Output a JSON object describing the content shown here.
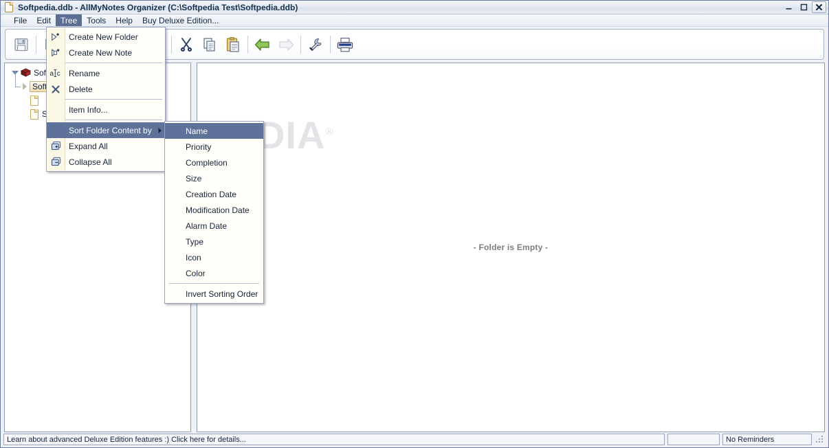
{
  "window": {
    "title": "Softpedia.ddb - AllMyNotes Organizer (C:\\Softpedia Test\\Softpedia.ddb)",
    "title_icon": "document-icon",
    "controls": {
      "minimize": "minimize-icon",
      "maximize": "maximize-icon",
      "close": "close-icon"
    }
  },
  "menubar": {
    "items": [
      {
        "label": "File",
        "active": false
      },
      {
        "label": "Edit",
        "active": false
      },
      {
        "label": "Tree",
        "active": true
      },
      {
        "label": "Tools",
        "active": false
      },
      {
        "label": "Help",
        "active": false
      },
      {
        "label": "Buy Deluxe Edition...",
        "active": false
      }
    ]
  },
  "toolbar": {
    "buttons": [
      {
        "name": "save-icon",
        "enabled": true
      },
      {
        "name": "separator",
        "enabled": false
      },
      {
        "name": "new-folder-icon",
        "enabled": true
      },
      {
        "name": "new-note-icon",
        "enabled": true
      },
      {
        "name": "separator",
        "enabled": false
      },
      {
        "name": "search-icon",
        "enabled": false
      },
      {
        "name": "separator",
        "enabled": false
      },
      {
        "name": "undo-icon",
        "enabled": false
      },
      {
        "name": "redo-icon",
        "enabled": false
      },
      {
        "name": "separator",
        "enabled": false
      },
      {
        "name": "cut-icon",
        "enabled": true
      },
      {
        "name": "copy-icon",
        "enabled": true
      },
      {
        "name": "paste-icon",
        "enabled": true
      },
      {
        "name": "separator",
        "enabled": false
      },
      {
        "name": "back-arrow-icon",
        "enabled": true
      },
      {
        "name": "forward-arrow-icon",
        "enabled": false
      },
      {
        "name": "separator",
        "enabled": false
      },
      {
        "name": "options-wrench-icon",
        "enabled": true
      },
      {
        "name": "separator",
        "enabled": false
      },
      {
        "name": "print-icon",
        "enabled": true
      }
    ]
  },
  "tree_menu": {
    "items": [
      {
        "label": "Create New Folder",
        "icon": "new-folder-icon",
        "type": "item",
        "selected": false
      },
      {
        "label": "Create New Note",
        "icon": "new-note-icon",
        "type": "item",
        "selected": false
      },
      {
        "type": "separator"
      },
      {
        "label": "Rename",
        "icon": "rename-abc-icon",
        "type": "item",
        "selected": false
      },
      {
        "label": "Delete",
        "icon": "delete-x-icon",
        "type": "item",
        "selected": false
      },
      {
        "type": "separator"
      },
      {
        "label": "Item Info...",
        "icon": "none",
        "type": "item",
        "selected": false
      },
      {
        "type": "separator"
      },
      {
        "label": "Sort Folder Content by",
        "icon": "none",
        "type": "submenu",
        "selected": true
      },
      {
        "label": "Expand All",
        "icon": "expand-all-icon",
        "type": "item",
        "selected": false
      },
      {
        "label": "Collapse All",
        "icon": "collapse-all-icon",
        "type": "item",
        "selected": false
      }
    ]
  },
  "sort_submenu": {
    "items": [
      {
        "label": "Name",
        "type": "item",
        "selected": true
      },
      {
        "label": "Priority",
        "type": "item",
        "selected": false
      },
      {
        "label": "Completion",
        "type": "item",
        "selected": false
      },
      {
        "label": "Size",
        "type": "item",
        "selected": false
      },
      {
        "label": "Creation Date",
        "type": "item",
        "selected": false
      },
      {
        "label": "Modification Date",
        "type": "item",
        "selected": false
      },
      {
        "label": "Alarm Date",
        "type": "item",
        "selected": false
      },
      {
        "label": "Type",
        "type": "item",
        "selected": false
      },
      {
        "label": "Icon",
        "type": "item",
        "selected": false
      },
      {
        "label": "Color",
        "type": "item",
        "selected": false
      },
      {
        "type": "separator"
      },
      {
        "label": "Invert Sorting Order",
        "type": "item",
        "selected": false
      }
    ]
  },
  "tree": {
    "rows": [
      {
        "label": "Softp",
        "icon": "book-icon",
        "expander": "expanded",
        "indent": 0,
        "selected": false
      },
      {
        "label": "Softp",
        "icon": "none",
        "expander": "collapsed",
        "indent": 1,
        "selected": true
      },
      {
        "label": "",
        "icon": "page-icon",
        "expander": "none",
        "indent": 1,
        "selected": false
      },
      {
        "label": "Softp",
        "icon": "page-icon",
        "expander": "none",
        "indent": 1,
        "selected": false
      }
    ]
  },
  "note_panel": {
    "empty_text": "- Folder is Empty -"
  },
  "watermark": {
    "text": "SOFTPEDIA",
    "mark": "®"
  },
  "statusbar": {
    "message": "Learn about advanced Deluxe Edition features :) Click here for details...",
    "small_panel": "",
    "reminders": "No Reminders"
  },
  "colors": {
    "menu_highlight": "#5e729a",
    "menubar_highlight": "#5a6e94",
    "menu_bg": "#fffef8",
    "gutter_bg": "#fbf8e6",
    "window_bg": "#eef1f6",
    "title_text": "#15314f",
    "empty_text": "#7d7d82",
    "tree_selected_bg": "#f0dfae"
  }
}
